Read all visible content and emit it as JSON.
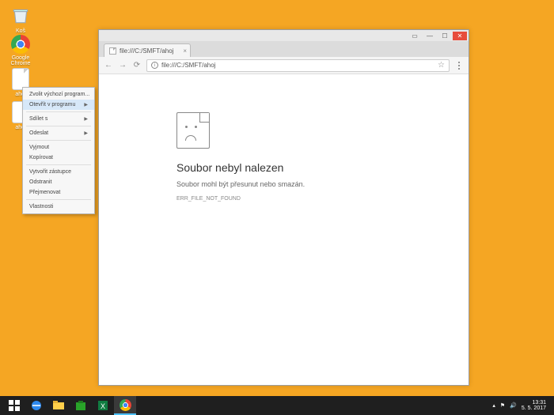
{
  "desktop": {
    "recycle_label": "Koš",
    "chrome_label": "Google Chrome",
    "file1_label": "ahoj",
    "file2_label": "ahoj"
  },
  "context_menu": {
    "items": [
      {
        "label": "Zvolit výchozí program...",
        "arrow": false
      },
      {
        "label": "Otevřít v programu",
        "arrow": true,
        "hover": true
      },
      {
        "label": "Sdílet s",
        "arrow": true
      },
      {
        "label": "Odeslat",
        "arrow": true
      },
      {
        "label": "Vyjmout",
        "arrow": false
      },
      {
        "label": "Kopírovat",
        "arrow": false
      },
      {
        "label": "Vytvořit zástupce",
        "arrow": false
      },
      {
        "label": "Odstranit",
        "arrow": false
      },
      {
        "label": "Přejmenovat",
        "arrow": false
      },
      {
        "label": "Vlastnosti",
        "arrow": false
      }
    ]
  },
  "browser": {
    "tab_title": "file:///C:/SMFT/ahoj",
    "url": "file:///C:/SMFT/ahoj",
    "error_title": "Soubor nebyl nalezen",
    "error_sub": "Soubor mohl být přesunut nebo smazán.",
    "error_code": "ERR_FILE_NOT_FOUND"
  },
  "taskbar": {
    "time": "13:31",
    "date": "5. 5. 2017"
  }
}
